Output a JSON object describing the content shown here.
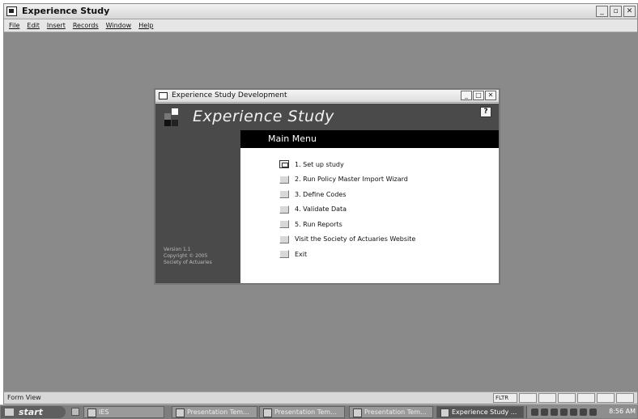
{
  "app": {
    "title": "Experience Study",
    "menu": [
      "File",
      "Edit",
      "Insert",
      "Records",
      "Window",
      "Help"
    ],
    "status_text": "Form View",
    "status_indicator": "FLTR"
  },
  "dialog": {
    "title": "Experience Study Development",
    "hero_title": "Experience Study",
    "help_icon": "?",
    "header": "Main Menu",
    "items": [
      {
        "label": "1.  Set up study"
      },
      {
        "label": "2.  Run Policy Master Import Wizard"
      },
      {
        "label": "3.  Define Codes"
      },
      {
        "label": "4.  Validate Data"
      },
      {
        "label": "5.  Run Reports"
      },
      {
        "label": "Visit the Society of Actuaries Website"
      },
      {
        "label": "Exit"
      }
    ],
    "version": {
      "line1": "Version 1.1",
      "line2": "Copyright © 2005",
      "line3": "Society of Actuaries"
    }
  },
  "taskbar": {
    "start": "start",
    "tasks": [
      {
        "label": "IES"
      },
      {
        "label": "Presentation Tem..."
      },
      {
        "label": "Presentation Tem..."
      },
      {
        "label": "Presentation Tem..."
      },
      {
        "label": "Experience Study ..."
      }
    ],
    "clock": "8:56 AM"
  }
}
